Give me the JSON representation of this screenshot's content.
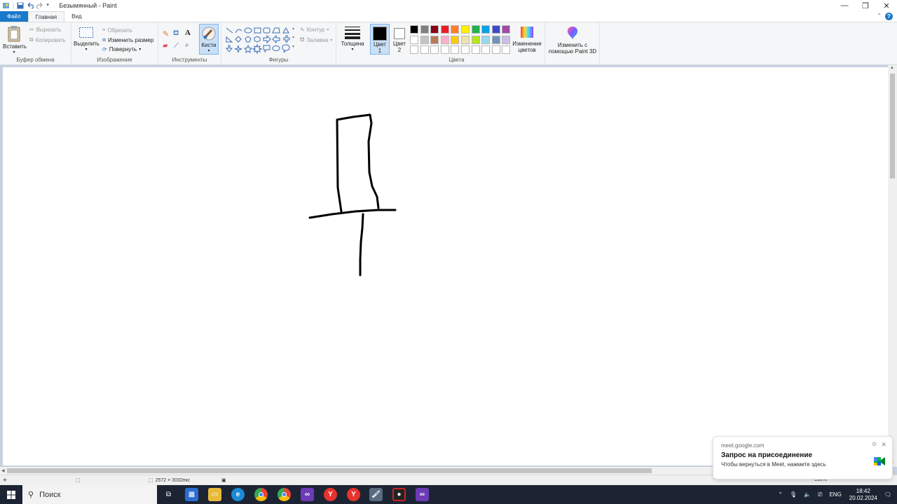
{
  "window": {
    "title": "Безымянный - Paint"
  },
  "tabs": {
    "file": "Файл",
    "home": "Главная",
    "view": "Вид"
  },
  "clipboard": {
    "paste": "Вставить",
    "cut": "Вырезать",
    "copy": "Копировать",
    "label": "Буфер обмена"
  },
  "image": {
    "select": "Выделить",
    "crop": "Обрезать",
    "resize": "Изменить размер",
    "rotate": "Повернуть",
    "label": "Изображение"
  },
  "tools": {
    "label": "Инструменты",
    "brushes": "Кисти"
  },
  "shapes": {
    "outline": "Контур",
    "fill": "Заливка",
    "label": "Фигуры"
  },
  "size": {
    "label": "Толщина"
  },
  "colors": {
    "color1_line1": "Цвет",
    "color1_line2": "1",
    "color2_line1": "Цвет",
    "color2_line2": "2",
    "edit_line1": "Изменение",
    "edit_line2": "цветов",
    "label": "Цвета",
    "paint3d_line1": "Изменить с",
    "paint3d_line2": "помощью Paint 3D",
    "color1_value": "#000000",
    "color2_value": "#ffffff",
    "palette_row1": [
      "#000000",
      "#7f7f7f",
      "#880015",
      "#ed1c24",
      "#ff7f27",
      "#fff200",
      "#22b14c",
      "#00a2e8",
      "#3f48cc",
      "#a349a4"
    ],
    "palette_row2": [
      "#ffffff",
      "#c3c3c3",
      "#b97a57",
      "#ffaec9",
      "#ffc90e",
      "#efe4b0",
      "#b5e61d",
      "#99d9ea",
      "#7092be",
      "#c8bfe7"
    ],
    "palette_row3": [
      "#ffffff",
      "#ffffff",
      "#ffffff",
      "#ffffff",
      "#ffffff",
      "#ffffff",
      "#ffffff",
      "#ffffff",
      "#ffffff",
      "#ffffff"
    ]
  },
  "status": {
    "dimensions": "2572 × 3032пкс",
    "zoom": "100%"
  },
  "toast": {
    "source": "meet.google.com",
    "title": "Запрос на присоединение",
    "message": "Чтобы вернуться в Meet, нажмите здесь"
  },
  "taskbar": {
    "search_placeholder": "Поиск",
    "lang": "ENG",
    "time": "18:42",
    "date": "20.02.2024"
  }
}
